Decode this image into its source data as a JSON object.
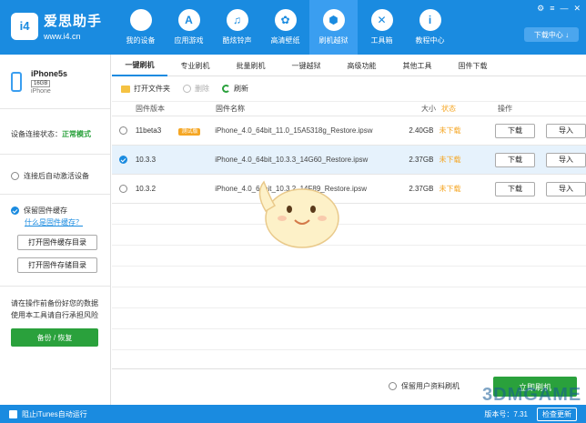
{
  "app": {
    "name": "爱思助手",
    "url": "www.i4.cn",
    "logo_text": "i4"
  },
  "nav": [
    {
      "label": "我的设备",
      "icon": "apple-icon",
      "glyph": ""
    },
    {
      "label": "应用游戏",
      "icon": "app-store-icon",
      "glyph": "A"
    },
    {
      "label": "酷炫铃声",
      "icon": "bell-icon",
      "glyph": "♫"
    },
    {
      "label": "高清壁纸",
      "icon": "flower-icon",
      "glyph": "✿"
    },
    {
      "label": "刷机越狱",
      "icon": "dropbox-icon",
      "glyph": "⬢"
    },
    {
      "label": "工具箱",
      "icon": "tools-icon",
      "glyph": "✕"
    },
    {
      "label": "教程中心",
      "icon": "info-icon",
      "glyph": "i"
    }
  ],
  "window": {
    "download_center": "下载中心 ↓"
  },
  "device": {
    "name": "iPhone5s",
    "capacity": "16GB",
    "type": "iPhone"
  },
  "sidebar": {
    "connection_label": "设备连接状态：",
    "connection_value": "正常模式",
    "auto_activate": "连接后自动激活设备",
    "keep_firmware": "保留固件缓存",
    "what_is_cache": "什么是固件缓存？",
    "open_cache_dir": "打开固件缓存目录",
    "open_storage_dir": "打开固件存储目录",
    "backup_note_1": "请在操作前备份好您的数据",
    "backup_note_2": "使用本工具请自行承担风险",
    "backup_button": "备份 / 恢复"
  },
  "tabs": [
    "一键刷机",
    "专业刷机",
    "批量刷机",
    "一键越狱",
    "高级功能",
    "其他工具",
    "固件下载"
  ],
  "toolbar": {
    "open_folder": "打开文件夹",
    "delete": "删除",
    "refresh": "刷新"
  },
  "table": {
    "headers": {
      "version": "固件版本",
      "name": "固件名称",
      "size": "大小",
      "status": "状态",
      "ops": "操作"
    },
    "rows": [
      {
        "version": "11beta3",
        "badge": "测试版",
        "name": "iPhone_4.0_64bit_11.0_15A5318g_Restore.ipsw",
        "size": "2.40GB",
        "status": "未下载",
        "download": "下载",
        "import": "导入"
      },
      {
        "version": "10.3.3",
        "badge": "",
        "name": "iPhone_4.0_64bit_10.3.3_14G60_Restore.ipsw",
        "size": "2.37GB",
        "status": "未下载",
        "download": "下载",
        "import": "导入"
      },
      {
        "version": "10.3.2",
        "badge": "",
        "name": "iPhone_4.0_64bit_10.3.2_14F89_Restore.ipsw",
        "size": "2.37GB",
        "status": "未下载",
        "download": "下载",
        "import": "导入"
      }
    ]
  },
  "bottom": {
    "keep_data": "保留用户资料刷机",
    "flash_now": "立即刷机"
  },
  "statusbar": {
    "block_itunes": "阻止iTunes自动运行",
    "version": "版本号：7.31",
    "check_update": "检查更新"
  },
  "watermark": "3DMGAME"
}
